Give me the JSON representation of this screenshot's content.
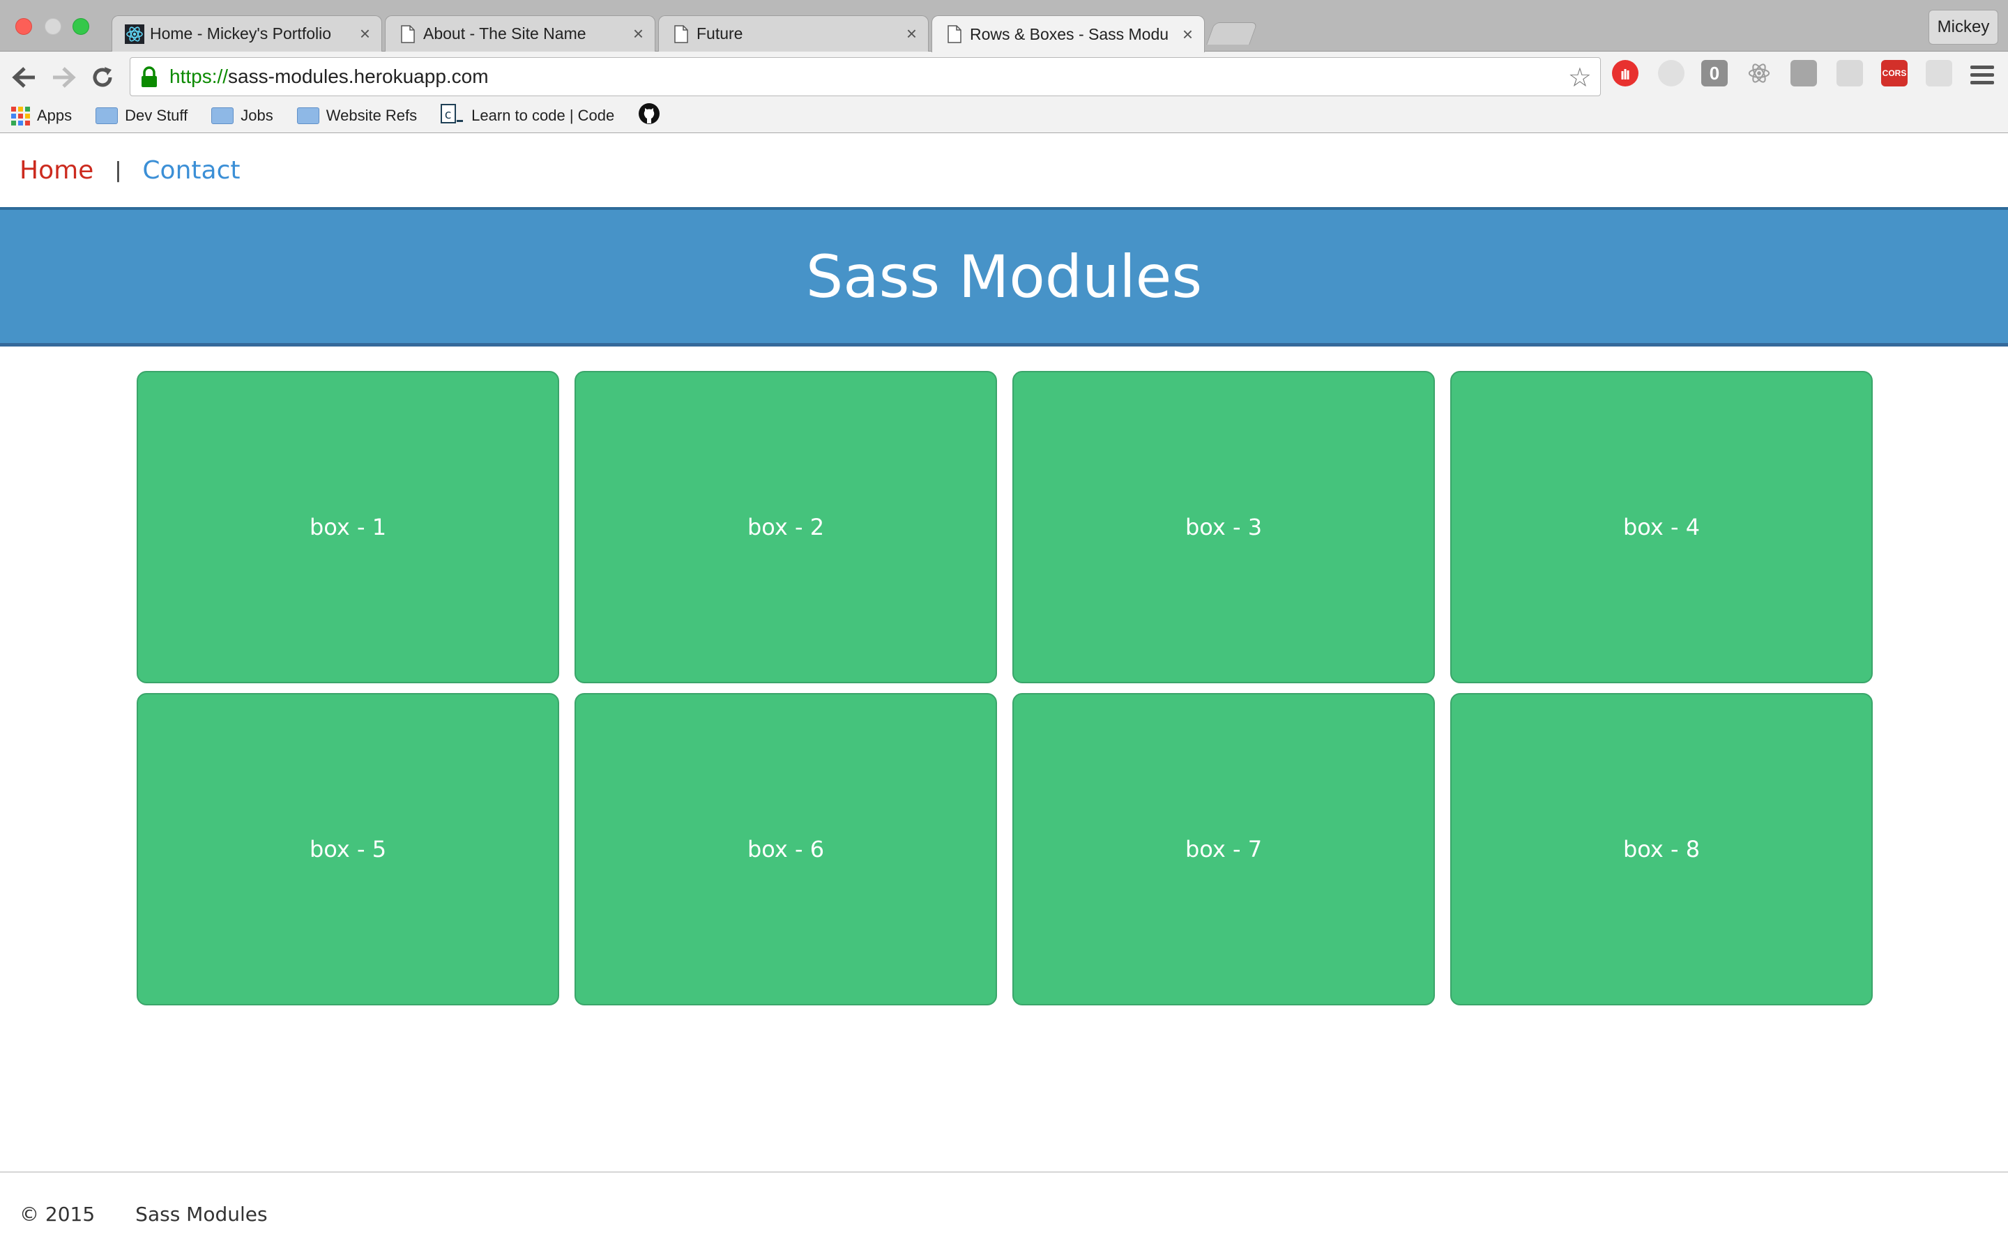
{
  "browser": {
    "tabs": [
      {
        "title": "Home - Mickey's Portfolio",
        "icon": "react-icon",
        "active": false
      },
      {
        "title": "About - The Site Name",
        "icon": "page-icon",
        "active": false
      },
      {
        "title": "Future",
        "icon": "page-icon",
        "active": false
      },
      {
        "title": "Rows & Boxes - Sass Modu",
        "icon": "page-icon",
        "active": true
      }
    ],
    "tab_close_glyph": "×",
    "profile_name": "Mickey",
    "address": {
      "scheme": "https://",
      "host": "sass-modules.herokuapp.com"
    },
    "bookmarks": [
      {
        "label": "Apps",
        "icon": "apps-grid-icon"
      },
      {
        "label": "Dev Stuff",
        "icon": "folder-icon"
      },
      {
        "label": "Jobs",
        "icon": "folder-icon"
      },
      {
        "label": "Website Refs",
        "icon": "folder-icon"
      },
      {
        "label": "Learn to code | Code",
        "icon": "codecademy-icon"
      }
    ],
    "extensions": [
      {
        "name": "adblock-icon",
        "color": "#e8312f"
      },
      {
        "name": "extension-icon",
        "color": "#cfcfcf"
      },
      {
        "name": "counter-icon",
        "color": "#8f8f8f",
        "text": "0"
      },
      {
        "name": "react-devtools-icon",
        "color": "#b0b0b0"
      },
      {
        "name": "extension-icon",
        "color": "#a6a6a6"
      },
      {
        "name": "extension-icon",
        "color": "#c9c9c9"
      },
      {
        "name": "cors-icon",
        "color": "#d3302a",
        "text": "CORS"
      },
      {
        "name": "extension-icon",
        "color": "#d2d2d2"
      }
    ]
  },
  "page": {
    "nav": {
      "home": "Home",
      "separator": "|",
      "contact": "Contact"
    },
    "header_title": "Sass Modules",
    "boxes": [
      "box - 1",
      "box - 2",
      "box - 3",
      "box - 4",
      "box - 5",
      "box - 6",
      "box - 7",
      "box - 8"
    ],
    "footer": {
      "copyright": "© 2015",
      "site_name": "Sass Modules"
    }
  },
  "colors": {
    "header_bg": "#4793c8",
    "box_bg": "#45c37c",
    "home_link": "#cc2a1e",
    "contact_link": "#3b8fd6"
  }
}
